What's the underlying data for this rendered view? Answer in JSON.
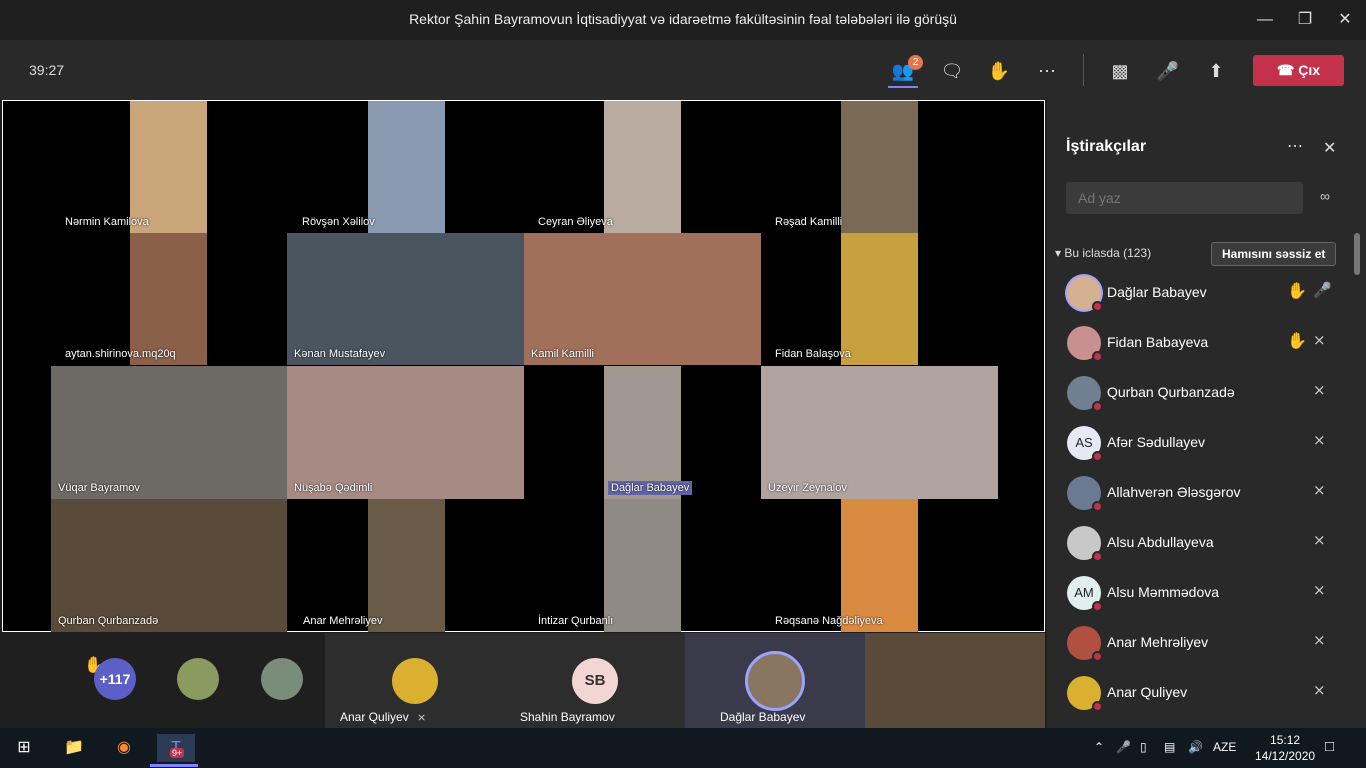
{
  "window": {
    "title": "Rektor Şahin Bayramovun İqtisadiyyat və idarəetmə fakültəsinin fəal tələbələri ilə görüşü"
  },
  "callbar": {
    "timer": "39:27",
    "participants_badge": "2",
    "leave_label": "Çıx"
  },
  "stage": {
    "tiles": [
      {
        "name": "Nərmin Kamilova",
        "bg": "#c9a57a"
      },
      {
        "name": "Rövşən Xəlilov",
        "bg": "#8a9ab0"
      },
      {
        "name": "Ceyran Əliyeva",
        "bg": "#b9aba0"
      },
      {
        "name": "Rəşad Kamilli",
        "bg": "#7a6a55"
      },
      {
        "name": "aytan.shirinova.mq20q",
        "bg": "#8a6048"
      },
      {
        "name": "Kənan Mustafayev",
        "bg": "#4a5560"
      },
      {
        "name": "Kamil Kamilli",
        "bg": "#a0705a"
      },
      {
        "name": "Fidan Balaşova",
        "bg": "#c8a040"
      },
      {
        "name": "Vüqar Bayramov",
        "bg": "#6d6a66"
      },
      {
        "name": "Nüşabə Qədimli",
        "bg": "#a88a84"
      },
      {
        "name": "Dağlar Babayev",
        "bg": "#a09890"
      },
      {
        "name": "Üzeyir Zeynalov",
        "bg": "#b0a4a0"
      },
      {
        "name": "Qurban Qurbanzadə",
        "bg": "#5a4a3a"
      },
      {
        "name": "Anar Mehrəliyev",
        "bg": "#6a5a48"
      },
      {
        "name": "İntizar Qurbanlı",
        "bg": "#908a85"
      },
      {
        "name": "Rəqsanə Nağdəliyeva",
        "bg": "#d88a40"
      }
    ]
  },
  "bottom": {
    "overflow_count": "+117",
    "cells": [
      {
        "name": "Anar Quliyev"
      },
      {
        "name": "Shahin Bayramov",
        "initials": "SB"
      },
      {
        "name": "Dağlar Babayev"
      }
    ]
  },
  "panel": {
    "title": "İştirakçılar",
    "search_placeholder": "Ad yaz",
    "section_label": "Bu iclasda (123)",
    "mute_all_label": "Hamısını səssiz et",
    "participants": [
      {
        "name": "Dağlar Babayev",
        "initials": "",
        "hand": true,
        "mic": "on"
      },
      {
        "name": "Fidan Babayeva",
        "initials": "",
        "hand": true,
        "mic": "off"
      },
      {
        "name": "Qurban Qurbanzadə",
        "initials": "",
        "hand": false,
        "mic": "off"
      },
      {
        "name": "Afər Sədullayev",
        "initials": "AS",
        "hand": false,
        "mic": "off"
      },
      {
        "name": "Allahverən Ələsgərov",
        "initials": "",
        "hand": false,
        "mic": "off"
      },
      {
        "name": "Alsu Abdullayeva",
        "initials": "",
        "hand": false,
        "mic": "off"
      },
      {
        "name": "Alsu Məmmədova",
        "initials": "AM",
        "hand": false,
        "mic": "off"
      },
      {
        "name": "Anar Mehrəliyev",
        "initials": "",
        "hand": false,
        "mic": "off"
      },
      {
        "name": "Anar Quliyev",
        "initials": "",
        "hand": false,
        "mic": "off"
      }
    ]
  },
  "taskbar": {
    "lang": "AZE",
    "time": "15:12",
    "date": "14/12/2020",
    "teams_badge": "9+"
  }
}
